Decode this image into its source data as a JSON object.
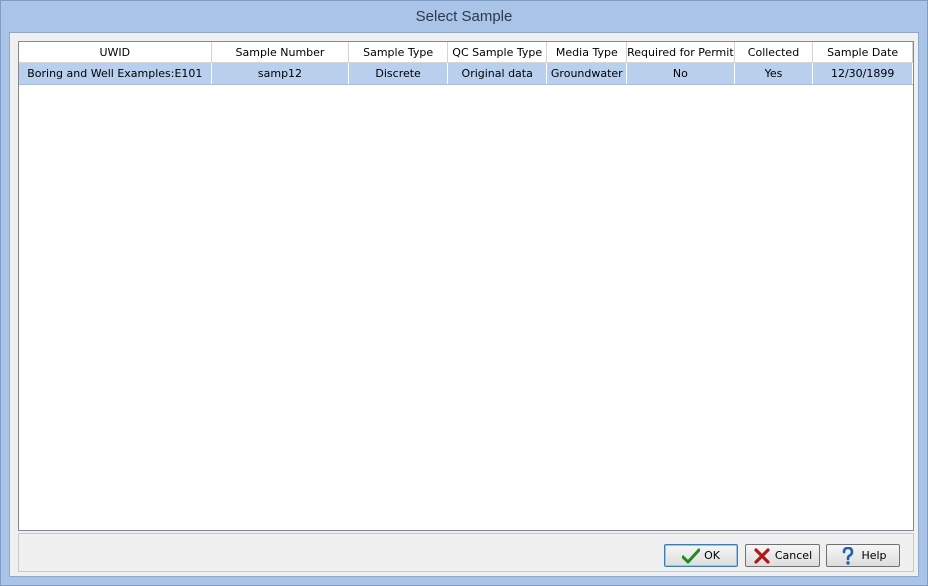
{
  "window": {
    "title": "Select Sample"
  },
  "grid": {
    "columns": [
      "UWID",
      "Sample Number",
      "Sample Type",
      "QC Sample Type",
      "Media Type",
      "Required for Permit",
      "Collected",
      "Sample Date"
    ],
    "rows": [
      [
        "Boring and Well Examples:E101",
        "samp12",
        "Discrete",
        "Original data",
        "Groundwater",
        "No",
        "Yes",
        "12/30/1899"
      ]
    ]
  },
  "buttons": {
    "ok": "OK",
    "cancel": "Cancel",
    "help": "Help"
  },
  "colors": {
    "selection": "#b8cfee",
    "frame": "#a9c4e6",
    "ok_icon": "#1e8a1e",
    "cancel_icon": "#b01818",
    "help_icon": "#1f5fb8"
  }
}
